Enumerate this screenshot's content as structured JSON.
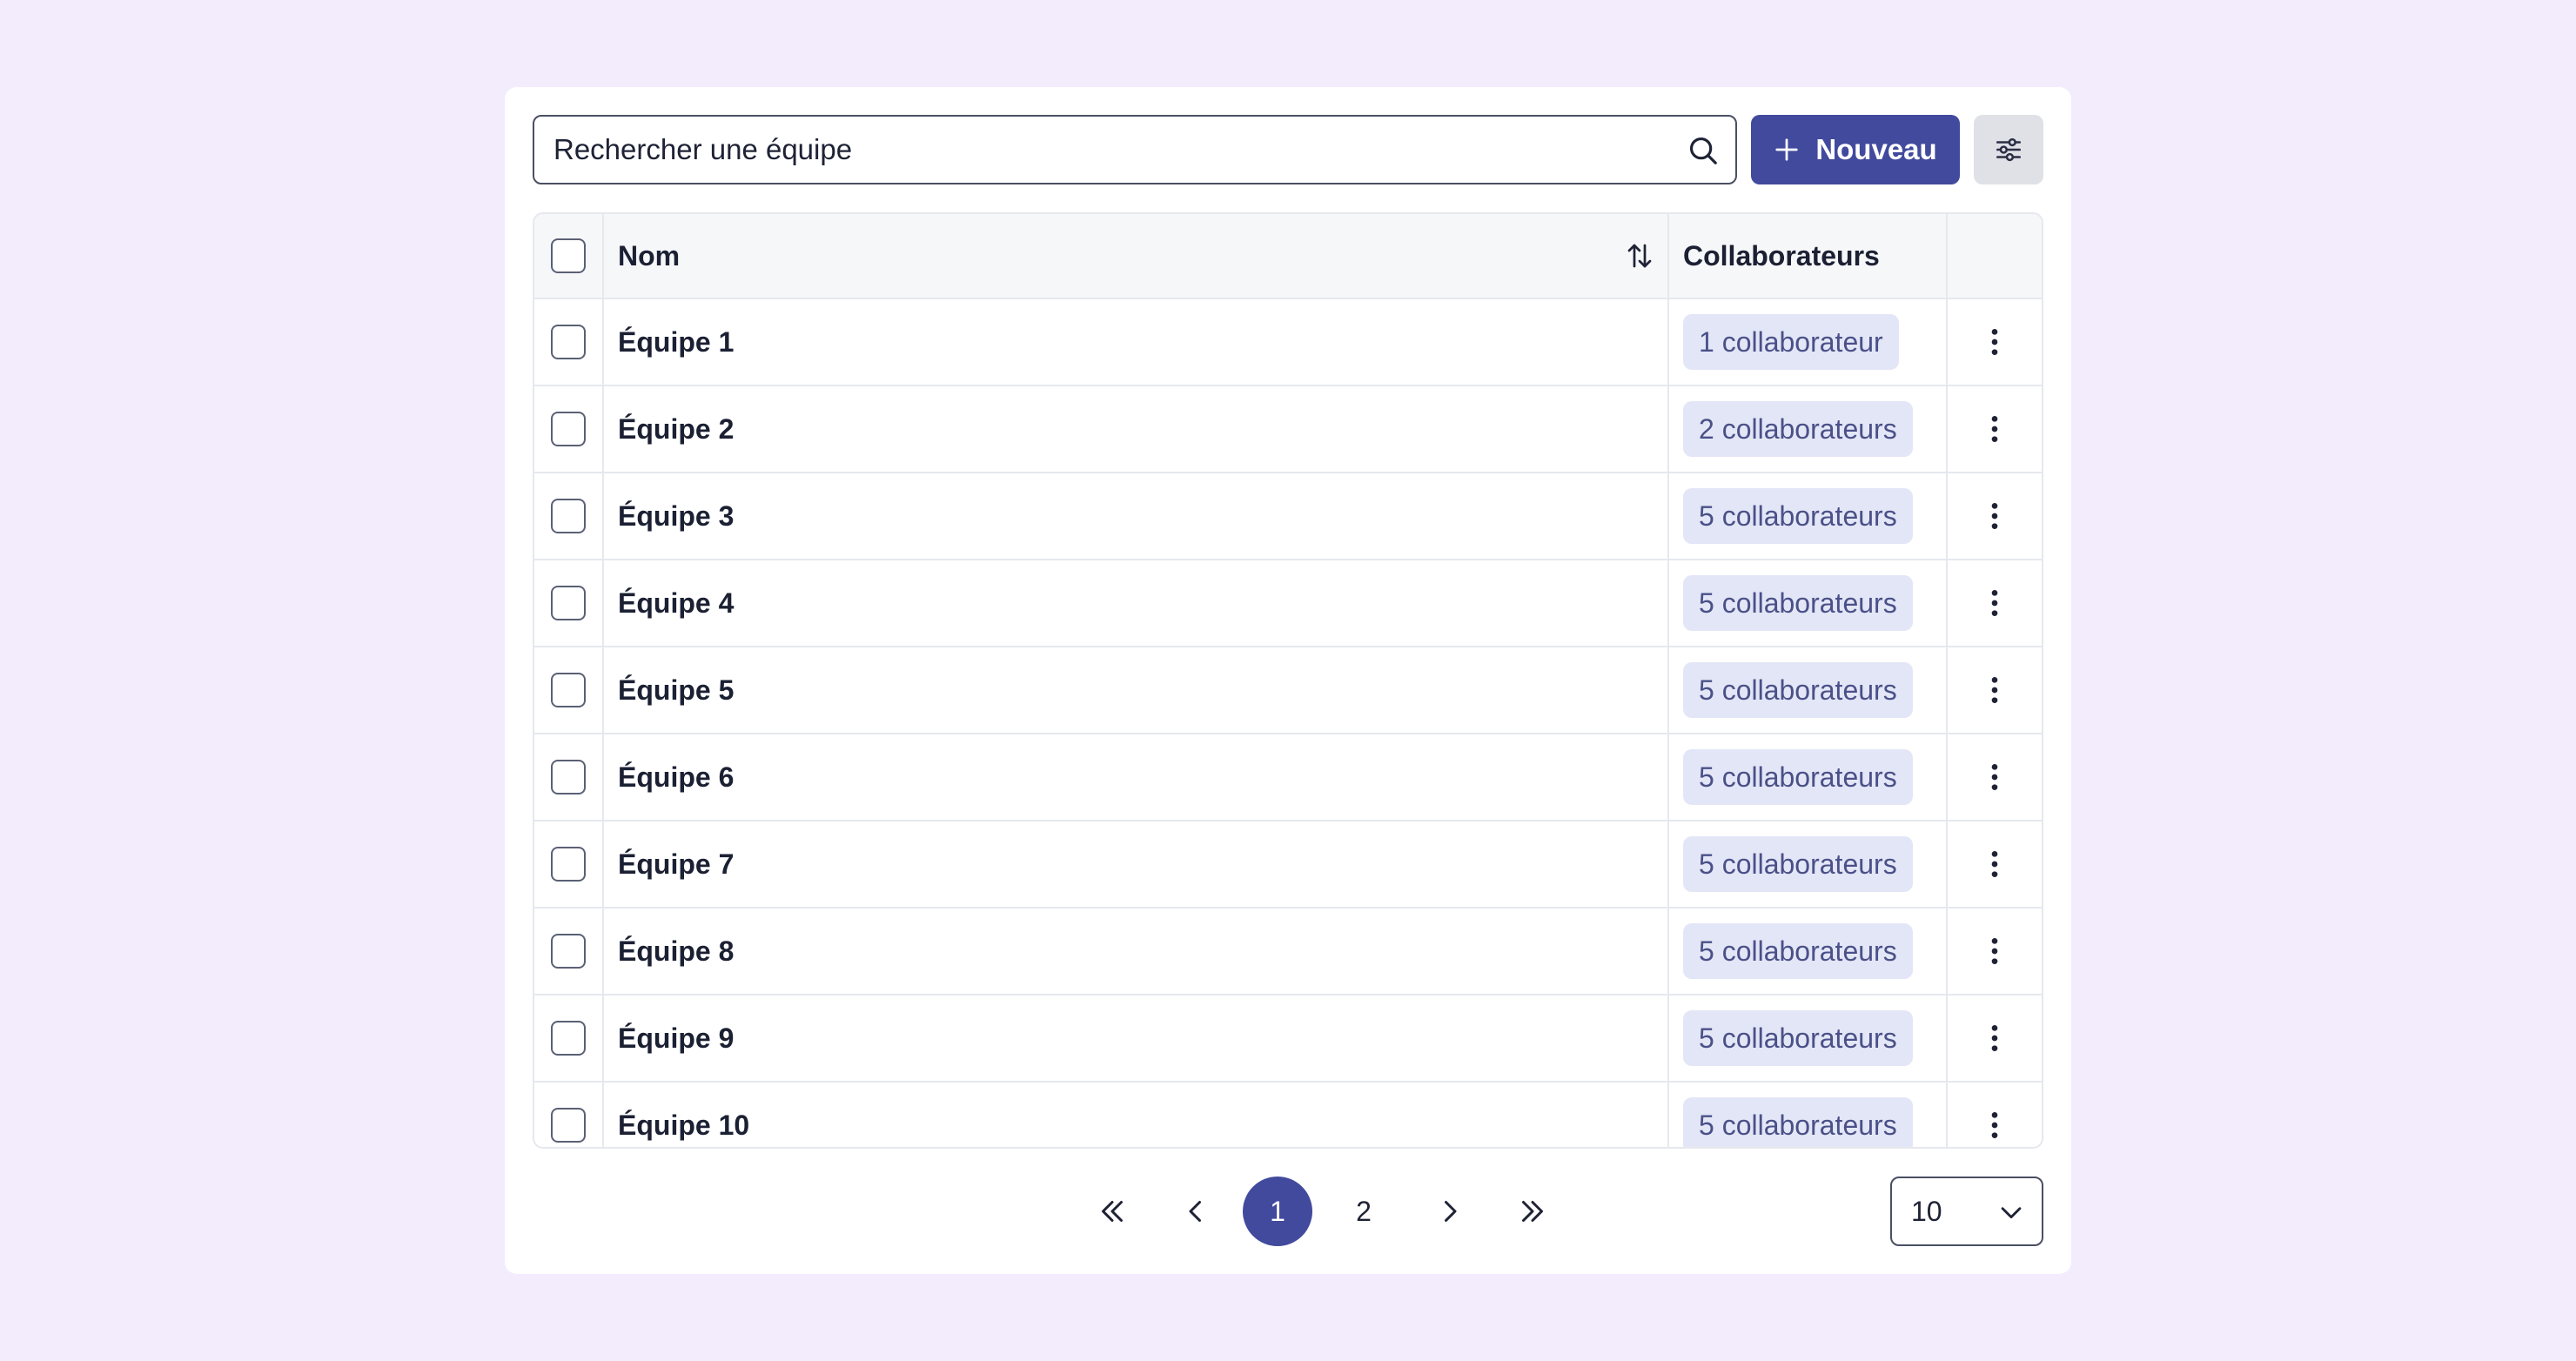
{
  "search": {
    "placeholder": "Rechercher une équipe",
    "value": ""
  },
  "toolbar": {
    "new_label": "Nouveau"
  },
  "table": {
    "columns": {
      "name": "Nom",
      "collaborators": "Collaborateurs"
    },
    "rows": [
      {
        "name": "Équipe 1",
        "collaborators": "1 collaborateur"
      },
      {
        "name": "Équipe 2",
        "collaborators": "2 collaborateurs"
      },
      {
        "name": "Équipe 3",
        "collaborators": "5 collaborateurs"
      },
      {
        "name": "Équipe 4",
        "collaborators": "5 collaborateurs"
      },
      {
        "name": "Équipe 5",
        "collaborators": "5 collaborateurs"
      },
      {
        "name": "Équipe 6",
        "collaborators": "5 collaborateurs"
      },
      {
        "name": "Équipe 7",
        "collaborators": "5 collaborateurs"
      },
      {
        "name": "Équipe 8",
        "collaborators": "5 collaborateurs"
      },
      {
        "name": "Équipe 9",
        "collaborators": "5 collaborateurs"
      },
      {
        "name": "Équipe 10",
        "collaborators": "5 collaborateurs"
      }
    ]
  },
  "pagination": {
    "pages": [
      "1",
      "2"
    ],
    "current": "1",
    "per_page": "10"
  },
  "colors": {
    "background": "#f3ecfd",
    "accent": "#414a9d",
    "badge_bg": "#e3e6f6",
    "badge_text": "#4a5088"
  },
  "icons": {
    "search": "search-icon",
    "add": "plus-icon",
    "settings": "sliders-icon",
    "sort": "sort-icon",
    "row_menu": "kebab-icon",
    "first": "double-chevron-left-icon",
    "prev": "chevron-left-icon",
    "next": "chevron-right-icon",
    "last": "double-chevron-right-icon",
    "dropdown": "chevron-down-icon"
  }
}
